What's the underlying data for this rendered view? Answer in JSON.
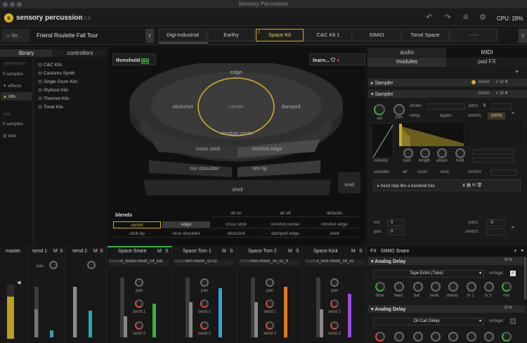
{
  "window": {
    "title": "Sensory Percussion"
  },
  "app": {
    "brand": "sensory percussion",
    "version": "1.2.4",
    "cpu": "CPU: 28%"
  },
  "setbar": {
    "file_label": "file...",
    "set_title": "Friend Roulette Fall Tour",
    "kits": [
      {
        "num": "",
        "name": "Digi-Industrial"
      },
      {
        "num": "",
        "name": "Earthy"
      },
      {
        "num": "3",
        "name": "Space Kit"
      },
      {
        "num": "",
        "name": "C&C Kit 1"
      },
      {
        "num": "",
        "name": "SIMIO"
      },
      {
        "num": "",
        "name": "Tonal Space"
      },
      {
        "num": "",
        "name": "- - -"
      }
    ]
  },
  "library": {
    "tabs": [
      "library",
      "controllers"
    ],
    "section1": "synthesized",
    "section2": "sets",
    "side1": [
      "samples",
      "effects",
      "kits"
    ],
    "side2": [
      "samples",
      "sets"
    ],
    "kits": [
      "C&C Kits",
      "Castores Synth",
      "Single Drum Kits",
      "Stylized Kits",
      "Themed Kits",
      "Tonal Kits"
    ]
  },
  "drum": {
    "threshold_label": "threshold",
    "learn_label": "learn...",
    "zones": {
      "edge": "edge",
      "stickshot": "stickshot",
      "center": "center",
      "damped": "damped",
      "rimshot_center": "rimshot center",
      "cross_stick": "cross stick",
      "rimshot_edge": "rimshot edge",
      "rim_shoulder": "rim shoulder",
      "rim_tip": "rim tip",
      "shell": "shell",
      "void": "void"
    },
    "blends_label": "blends",
    "blend_actions": [
      "all on",
      "all off",
      "defaults"
    ],
    "blend_row1": [
      "center",
      "edge",
      "cross stick",
      "rimshot center",
      "rimshot edge"
    ],
    "blend_row2": [
      "stick tip",
      "stick shoulder",
      "stickshot",
      "damped edge",
      "shell"
    ]
  },
  "right": {
    "tabs_top": [
      "audio",
      "MIDI"
    ],
    "tabs_bottom": [
      "modules",
      "pad FX"
    ],
    "module1_title": "Sampler",
    "module2_title": "Sampler",
    "blend_label": "blend:",
    "choke": "choke:",
    "retrig": "retrig.",
    "legato": "legato:",
    "pitch": "pitch:",
    "pitch_val": "0",
    "stretch": "stretch:",
    "stretch_val": "100%",
    "vol": "vol",
    "pan": "pan",
    "velocity": "velocity",
    "knobs": [
      "start",
      "length",
      "attack",
      "hold"
    ],
    "samples": "samples",
    "all": "all",
    "cycle": "cycle:",
    "rand": "rand:",
    "control": "control:",
    "sample_name": "hand clap like a baseball bas",
    "vol_label": "vol:",
    "vol_val": "0",
    "pan_label": "pan:",
    "pan_val": "0",
    "pitch2": "pitch:",
    "pitch2_val": "-0",
    "stretch2": "stretch:"
  },
  "mixer": {
    "channels": [
      {
        "name": "master",
        "m": "",
        "s": "",
        "input": ""
      },
      {
        "name": "send 1",
        "m": "M",
        "s": "S",
        "input": ""
      },
      {
        "name": "send 2",
        "m": "M",
        "s": "S",
        "input": ""
      },
      {
        "name": "Space Snare",
        "m": "M",
        "s": "S",
        "input": "4_snare-mesh_14_lud"
      },
      {
        "name": "Space Tom 1",
        "m": "M",
        "s": "S",
        "input": "tom-mesh_12-cc"
      },
      {
        "name": "Space Tom 2",
        "m": "M",
        "s": "S",
        "input": "tom-mesh_15_cc_ft"
      },
      {
        "name": "Space Kick",
        "m": "M",
        "s": "S",
        "input": "3_kick-mesh_16_cc"
      }
    ],
    "pan": "pan",
    "send1": "send 1",
    "send2": "send 2",
    "model": "model"
  },
  "fx": {
    "label": "FX",
    "title": "SIMIO Snare",
    "delay1": {
      "title": "Analog Delay",
      "preset": "Tape Echo (Tube)",
      "vintage": "vintage:",
      "knobs": [
        "time",
        "feed",
        "bal",
        "level",
        "stereo",
        "fx 1",
        "fx 2",
        "mix"
      ]
    },
    "delay2": {
      "title": "Analog Delay",
      "preset": "Oil Can Delay",
      "vintage": "vintage:"
    }
  },
  "colors": {
    "accent": "#d4b21d",
    "green": "#3cb043",
    "red": "#d84b3c",
    "blue": "#3aa0d8",
    "orange": "#e0782a",
    "purple": "#9b4ad8",
    "teal": "#2aa8a8"
  }
}
